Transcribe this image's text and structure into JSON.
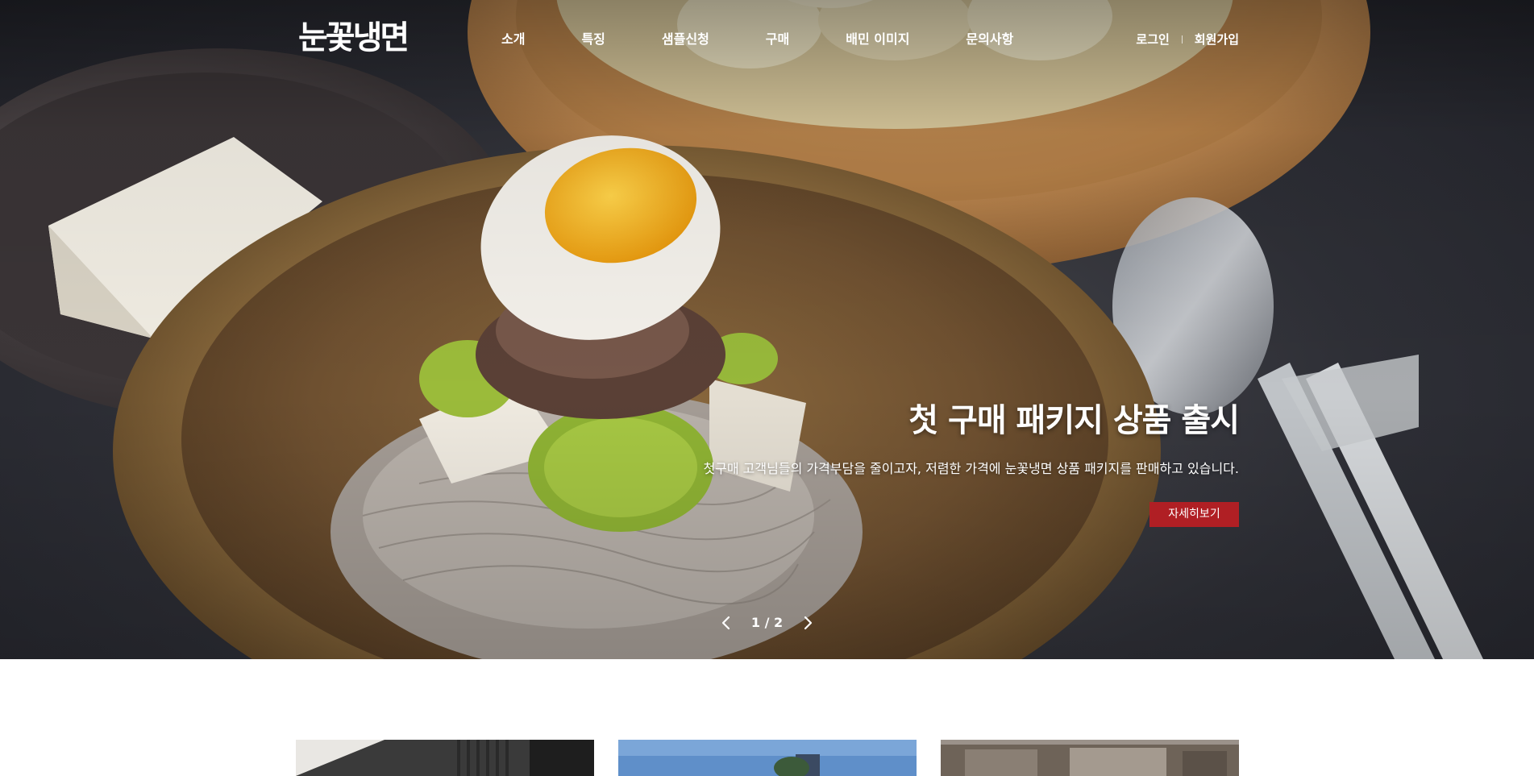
{
  "header": {
    "logo": "눈꽃냉면",
    "nav": [
      {
        "label": "소개"
      },
      {
        "label": "특징"
      },
      {
        "label": "샘플신청"
      },
      {
        "label": "구매"
      },
      {
        "label": "배민 이미지"
      },
      {
        "label": "문의사항"
      }
    ],
    "util": {
      "login": "로그인",
      "signup": "회원가입"
    }
  },
  "hero": {
    "title": "첫 구매 패키지 상품 출시",
    "description": "첫구매 고객님들의 가격부담을 줄이고자, 저렴한 가격에 눈꽃냉면 상품 패키지를 판매하고 있습니다.",
    "button": "자세히보기",
    "button_color": "#b01f24",
    "pagination": "1 / 2",
    "prev_icon": "chevron-left-icon",
    "next_icon": "chevron-right-icon"
  },
  "cards": [
    {
      "name": "card-1"
    },
    {
      "name": "card-2"
    },
    {
      "name": "card-3"
    }
  ]
}
